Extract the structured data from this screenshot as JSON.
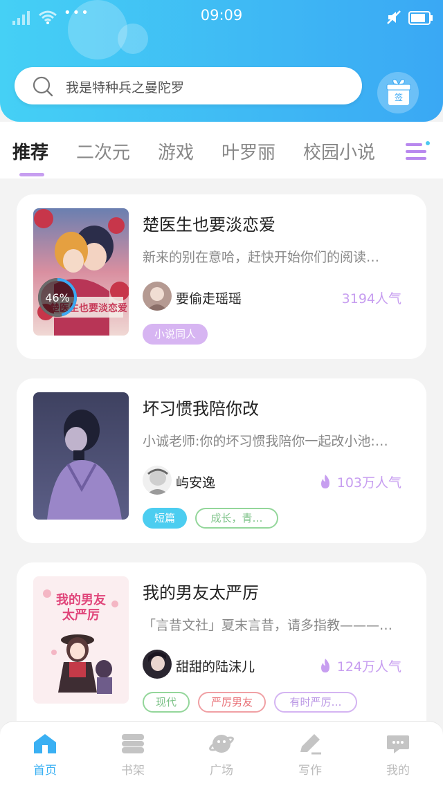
{
  "status_bar": {
    "time": "09:09",
    "dots": "•••"
  },
  "search": {
    "placeholder": "我是特种兵之曼陀罗"
  },
  "gift": {
    "label": "签"
  },
  "tabs": [
    {
      "label": "推荐",
      "active": true
    },
    {
      "label": "二次元"
    },
    {
      "label": "游戏"
    },
    {
      "label": "叶罗丽"
    },
    {
      "label": "校园小说"
    }
  ],
  "cards": [
    {
      "title": "楚医生也要淡恋爱",
      "description": "新来的别在意哈，赶快开始你们的阅读…",
      "author": "要偷走瑶瑶",
      "popularity": "3194人气",
      "progress": "46%",
      "cover_text": "楚医生也要淡恋爱",
      "tags": [
        {
          "label": "小说同人",
          "style": "filled-purple"
        }
      ]
    },
    {
      "title": "坏习惯我陪你改",
      "description": "小诚老师:你的坏习惯我陪你一起改小池:…",
      "author": "屿安逸",
      "popularity": "103万人气",
      "tags": [
        {
          "label": "短篇",
          "style": "filled-cyan"
        },
        {
          "label": "成长，青…",
          "style": "outline-green"
        }
      ]
    },
    {
      "title": "我的男友太严厉",
      "description": "「言昔文社」夏末言昔，请多指教———…",
      "author": "甜甜的陆沫儿",
      "popularity": "124万人气",
      "cover_text": "我的男友太严厉",
      "tags": [
        {
          "label": "现代",
          "style": "outline-green"
        },
        {
          "label": "严厉男友",
          "style": "outline-red"
        },
        {
          "label": "有时严厉…",
          "style": "outline-purple"
        }
      ]
    }
  ],
  "bottom_nav": [
    {
      "label": "首页",
      "icon": "home-icon",
      "active": true
    },
    {
      "label": "书架",
      "icon": "bookshelf-icon"
    },
    {
      "label": "广场",
      "icon": "planet-icon"
    },
    {
      "label": "写作",
      "icon": "pencil-icon"
    },
    {
      "label": "我的",
      "icon": "chat-bubble-icon"
    }
  ],
  "colors": {
    "header_start": "#45d0f5",
    "header_end": "#3aa8f4",
    "accent_purple": "#c79ef0",
    "nav_active": "#3ab0f3"
  }
}
